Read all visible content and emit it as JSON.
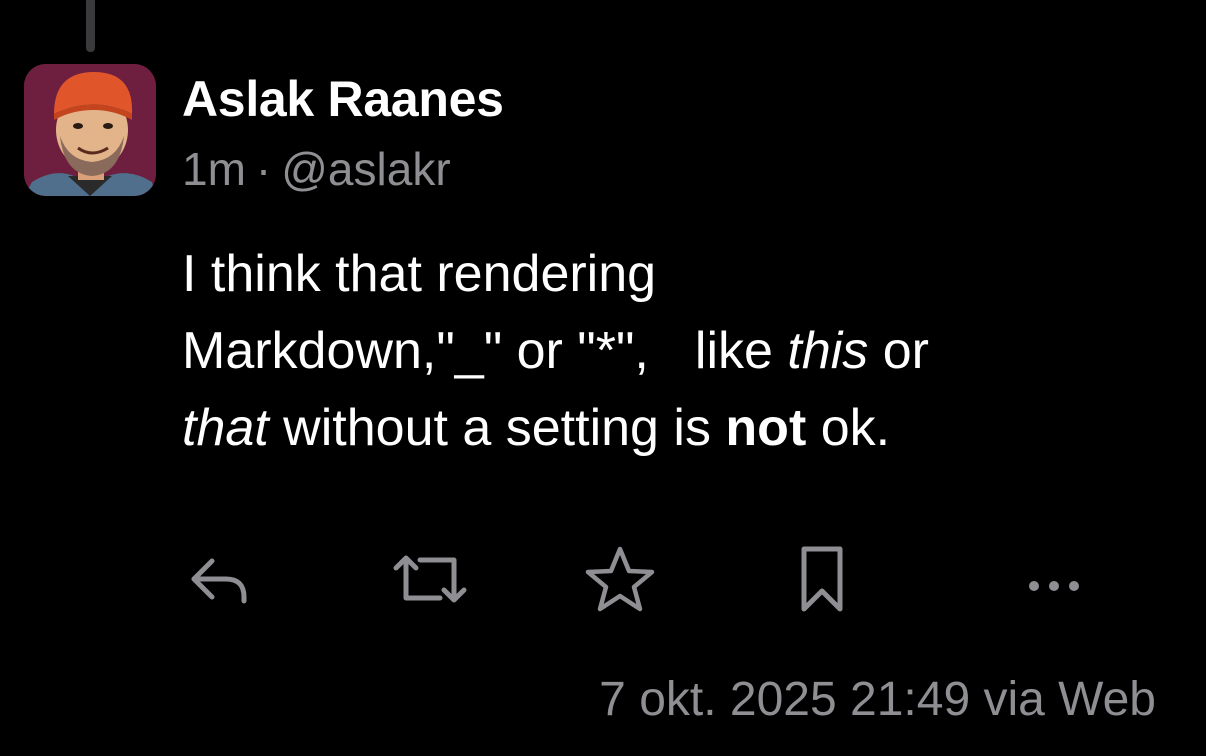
{
  "post": {
    "author": {
      "name": "Aslak Raanes",
      "handle": "@aslakr"
    },
    "relative_time": "1m",
    "separator": "·",
    "body": {
      "line1": "I think that rendering",
      "line2_part1": "Markdown,\"_\" or \"*\",",
      "line2_part2": "like ",
      "line2_italic": "this",
      "line2_part3": " or",
      "line3_italic": "that",
      "line3_part1": " without a setting is ",
      "line3_bold": "not",
      "line3_part2": " ok."
    },
    "timestamp": "7 okt. 2025 21:49 via Web"
  },
  "actions": [
    {
      "name": "reply",
      "icon": "reply-icon"
    },
    {
      "name": "boost",
      "icon": "boost-icon"
    },
    {
      "name": "favourite",
      "icon": "star-icon"
    },
    {
      "name": "bookmark",
      "icon": "bookmark-icon"
    },
    {
      "name": "more",
      "icon": "more-icon"
    }
  ],
  "colors": {
    "background": "#000000",
    "primary_text": "#ffffff",
    "secondary_text": "#8e8e93",
    "icon": "#8e8e93",
    "thread_line": "#3a3a3c"
  }
}
